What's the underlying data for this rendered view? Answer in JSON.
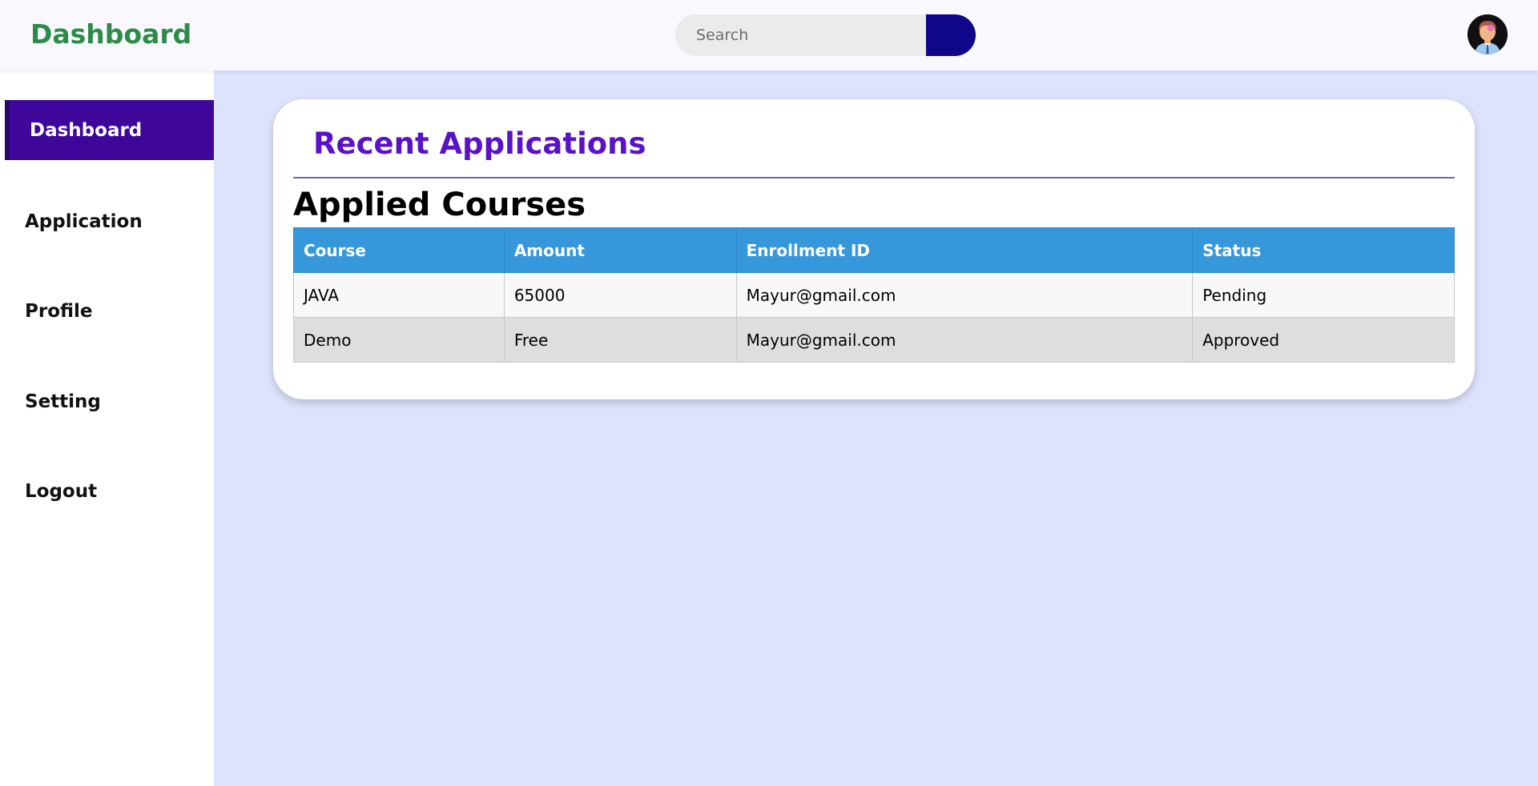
{
  "header": {
    "logo": "Dashboard",
    "search_placeholder": "Search",
    "search_value": ""
  },
  "sidebar": {
    "items": [
      {
        "label": "Dashboard",
        "active": true
      },
      {
        "label": "Application",
        "active": false
      },
      {
        "label": "Profile",
        "active": false
      },
      {
        "label": "Setting",
        "active": false
      },
      {
        "label": "Logout",
        "active": false
      }
    ]
  },
  "main": {
    "card_title": "Recent Applications",
    "section_title": "Applied Courses",
    "table": {
      "headers": [
        "Course",
        "Amount",
        "Enrollment ID",
        "Status"
      ],
      "rows": [
        [
          "JAVA",
          "65000",
          "Mayur@gmail.com",
          "Pending"
        ],
        [
          "Demo",
          "Free",
          "Mayur@gmail.com",
          "Approved"
        ]
      ]
    }
  },
  "colors": {
    "logo": "#2e8b47",
    "active_nav": "#3e0699",
    "card_title": "#5a12c9",
    "table_header": "#3797db",
    "search_button": "#0f0689",
    "page_background": "#dde2fd"
  },
  "icons": {
    "search_button": "search-button-icon",
    "avatar": "user-avatar-icon"
  }
}
